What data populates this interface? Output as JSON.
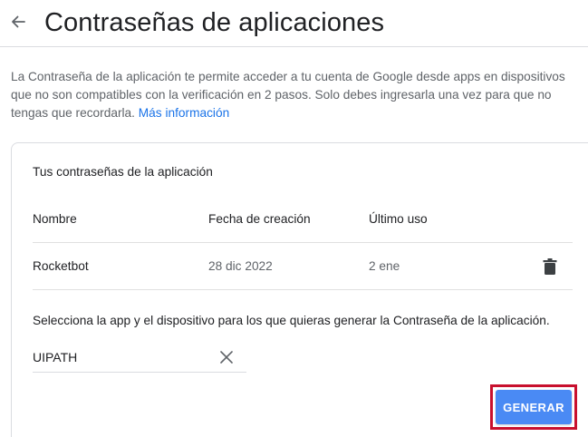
{
  "header": {
    "back_icon": "arrow-left-icon",
    "title": "Contraseñas de aplicaciones"
  },
  "description": {
    "text": "La Contraseña de la aplicación te permite acceder a tu cuenta de Google desde apps en dispositivos que no son compatibles con la verificación en 2 pasos. Solo debes ingresarla una vez para que no tengas que recordarla.",
    "link_label": "Más información"
  },
  "card": {
    "title": "Tus contraseñas de la aplicación",
    "columns": [
      "Nombre",
      "Fecha de creación",
      "Último uso"
    ],
    "rows": [
      {
        "name": "Rocketbot",
        "created": "28 dic 2022",
        "last_used": "2 ene",
        "delete_icon": "trash-icon"
      }
    ],
    "select_label": "Selecciona la app y el dispositivo para los que quieras generar la Contraseña de la aplicación.",
    "app_input": {
      "value": "UIPATH",
      "clear_icon": "close-icon"
    },
    "generate_label": "GENERAR"
  },
  "colors": {
    "accent": "#1a73e8",
    "button": "#4a8af4",
    "highlight": "#c8102e"
  }
}
